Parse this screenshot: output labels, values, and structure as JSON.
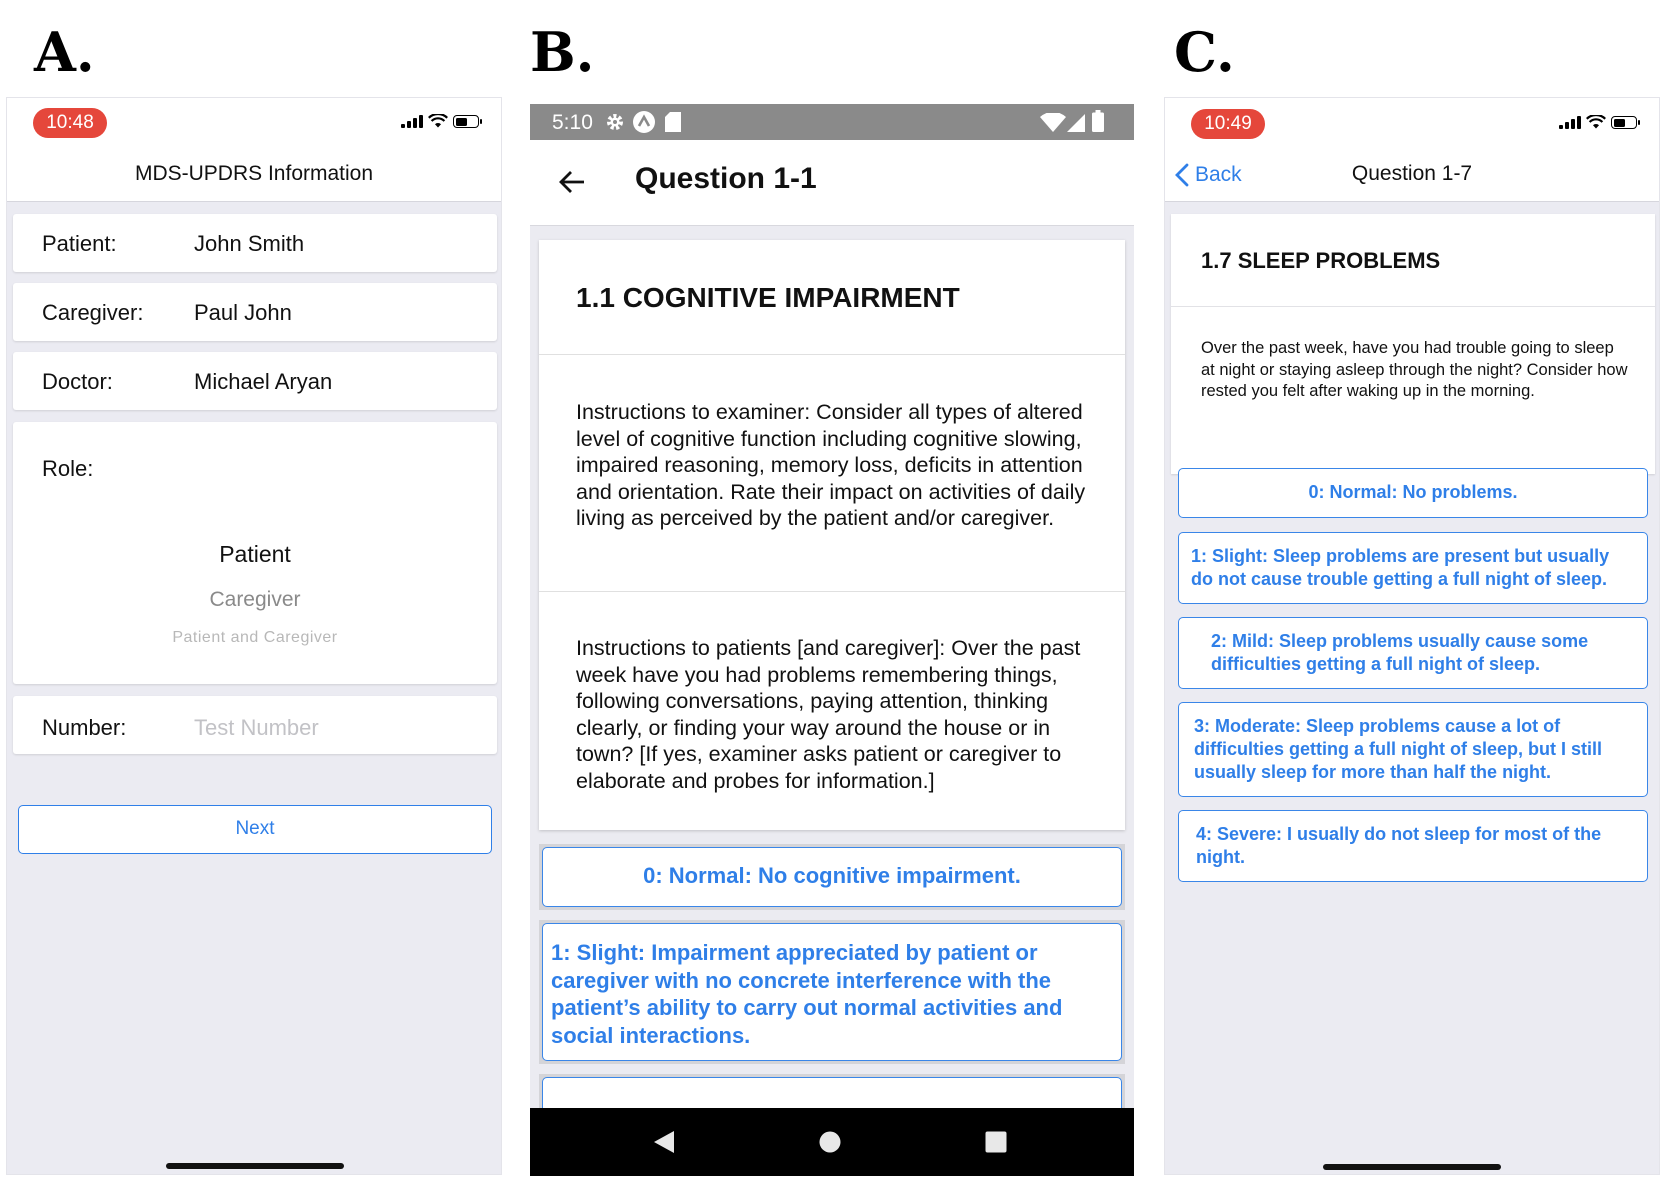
{
  "panel_labels": {
    "a": "A.",
    "b": "B.",
    "c": "C."
  },
  "panel_a": {
    "time": "10:48",
    "nav_title": "MDS-UPDRS Information",
    "fields": {
      "patient": {
        "label": "Patient:",
        "value": "John Smith"
      },
      "caregiver": {
        "label": "Caregiver:",
        "value": "Paul John"
      },
      "doctor": {
        "label": "Doctor:",
        "value": "Michael Aryan"
      }
    },
    "role": {
      "label": "Role:",
      "options": [
        "Patient",
        "Caregiver",
        "Patient and Caregiver"
      ],
      "selected": "Patient"
    },
    "number": {
      "label": "Number:",
      "placeholder": "Test Number"
    },
    "next_label": "Next"
  },
  "panel_b": {
    "time": "5:10",
    "title": "Question 1-1",
    "heading": "1.1 COGNITIVE IMPAIRMENT",
    "examiner_instructions": "Instructions to examiner: Consider all types of altered level of cognitive function including cognitive slowing, impaired reasoning, memory loss, deficits in attention and orientation. Rate their impact on activities of daily living as perceived by the patient and/or caregiver.",
    "patient_instructions": "Instructions to patients [and caregiver]: Over the past week have you had problems remembering things, following conversations, paying attention, thinking clearly, or finding your way around the house or in town? [If yes, examiner asks patient or caregiver to elaborate and probes for information.]",
    "options": [
      "0: Normal: No cognitive impairment.",
      "1: Slight: Impairment appreciated by patient or caregiver with no concrete interference with the patient’s ability to carry out normal activities and social interactions."
    ]
  },
  "panel_c": {
    "time": "10:49",
    "back_label": "Back",
    "title": "Question 1-7",
    "heading": "1.7 SLEEP PROBLEMS",
    "question": "Over the past week, have you had trouble going to sleep at night or staying asleep through the night? Consider how rested you felt after waking up in the morning.",
    "options": [
      "0: Normal: No problems.",
      "1: Slight: Sleep problems are present but usually do not cause trouble getting a full night of sleep.",
      "2: Mild: Sleep problems usually cause some difficulties getting a full night of sleep.",
      "3: Moderate: Sleep problems cause a lot of difficulties getting a full night of sleep, but I still usually sleep for more than half the night.",
      "4: Severe: I usually do not sleep for most of the night."
    ]
  },
  "colors": {
    "accent": "#2f7fe8",
    "time_pill": "#e5473b",
    "android_status": "#8a8a8a"
  },
  "icons": [
    "signal-icon",
    "wifi-icon",
    "battery-icon",
    "settings-gear-icon",
    "accessibility-icon",
    "sd-card-icon",
    "back-arrow-icon",
    "chevron-left-icon",
    "nav-back-triangle-icon",
    "nav-home-circle-icon",
    "nav-recents-square-icon"
  ]
}
